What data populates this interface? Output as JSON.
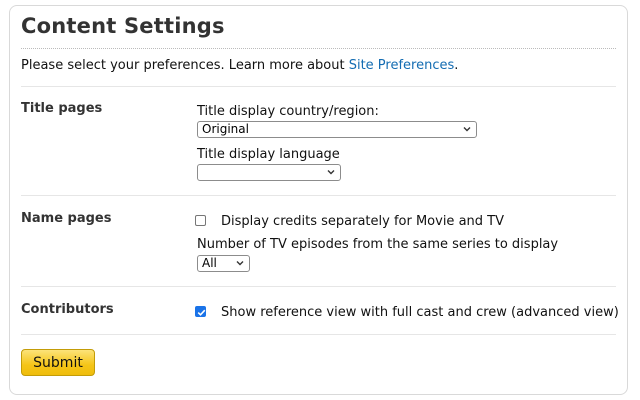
{
  "page": {
    "title": "Content Settings",
    "intro_text": "Please select your preferences. Learn more about ",
    "intro_link": "Site Preferences",
    "intro_suffix": "."
  },
  "title_pages": {
    "label": "Title pages",
    "country_label": "Title display country/region:",
    "country_value": "Original",
    "language_label": "Title display language",
    "language_value": ""
  },
  "name_pages": {
    "label": "Name pages",
    "credits_label": "Display credits separately for Movie and TV",
    "credits_checked": false,
    "episodes_label": "Number of TV episodes from the same series to display",
    "episodes_value": "All"
  },
  "contributors": {
    "label": "Contributors",
    "reference_label": "Show reference view with full cast and crew (advanced view)",
    "reference_checked": true
  },
  "actions": {
    "submit_label": "Submit"
  },
  "colors": {
    "link": "#136cb2",
    "submit": "#f5c518",
    "checkbox_checked": "#1a73e8"
  }
}
